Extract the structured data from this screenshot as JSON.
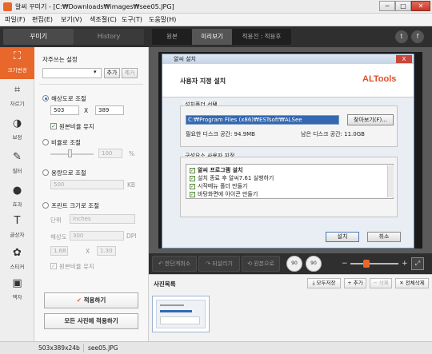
{
  "window": {
    "title": "알씨 꾸미기 - [C:₩Downloads₩images₩see05.JPG]",
    "min_label": "─",
    "max_label": "□",
    "close_label": "✕"
  },
  "menu": [
    "파일(F)",
    "편집(E)",
    "보기(V)",
    "색조절(C)",
    "도구(T)",
    "도움말(H)"
  ],
  "header": {
    "tabs": [
      "꾸미기",
      "History"
    ],
    "view_modes": [
      "원본",
      "미리보기",
      "적용전 : 적용후"
    ],
    "twitter": "t",
    "facebook": "f"
  },
  "sidebar": {
    "tools": [
      {
        "icon": "⛶",
        "label": "크기변경"
      },
      {
        "icon": "⌗",
        "label": "자르기"
      },
      {
        "icon": "◑",
        "label": "보정"
      },
      {
        "icon": "✎",
        "label": "필터"
      },
      {
        "icon": "●",
        "label": "효과"
      },
      {
        "icon": "T",
        "label": "글상자"
      },
      {
        "icon": "✿",
        "label": "스티커"
      },
      {
        "icon": "▣",
        "label": "액자"
      }
    ]
  },
  "panel": {
    "favorites_label": "자주쓰는 설정",
    "add_btn": "추가",
    "remove_btn": "제거",
    "resolution_label": "해상도로 조절",
    "width": "503",
    "x_sep": "X",
    "height": "389",
    "keep_ratio_label": "원본비율 유지",
    "keep_ratio_check": "✓",
    "ratio_label": "비율로 조절",
    "ratio_value": "100",
    "percent": "%",
    "filesize_label": "용량으로 조절",
    "filesize_value": "500",
    "kb": "KB",
    "print_label": "프린트 크기로 조절",
    "unit_label": "단위",
    "unit_value": "inches",
    "dpi_label": "해상도",
    "dpi_value": "300",
    "dpi_unit": "DPI",
    "print_w": "1.68",
    "print_h": "1.30",
    "print_keep_ratio": "원본비율 유지",
    "apply_btn": "적용하기",
    "apply_check": "✔",
    "apply_all_btn": "모든 사진에 적용하기"
  },
  "dialog": {
    "title": "알씨 설치",
    "close": "X",
    "heading": "사용자 지정 설치",
    "logo": "ALTools",
    "folder_group": "설치폴더 선택",
    "path": "C:₩Program Files (x86)₩ESTsoft₩ALSee",
    "browse_btn": "찾아보기(F)...",
    "disk_required": "필요한 디스크 공간: 94.9MB",
    "disk_free": "남은 디스크 공간: 11.0GB",
    "components_group": "구성요소 사용자 지정",
    "components": [
      "알씨 프로그램 설치",
      "설치 종료 후 알씨7.61 실행하기",
      "시작메뉴 폴더 만들기",
      "바탕화면에 아이콘 만들기"
    ],
    "check_mark": "✓",
    "install_btn": "설치",
    "cancel_btn": "취소"
  },
  "toolbar": {
    "undo": "↶ 한단계취소",
    "redo": "↷ 되살리기",
    "original": "⟲ 원본으로",
    "rot_left": "90",
    "rot_right": "90",
    "zoom_minus": "−",
    "zoom_plus": "+",
    "fit": "⤢",
    "zoom_level_fraction": 0.33
  },
  "photolist": {
    "label": "사진목록",
    "save_all": "모두저장",
    "add": "+ 추가",
    "delete": "− 삭제",
    "delete_all": "✕ 전체삭제"
  },
  "statusbar": {
    "dimensions": "503x389x24b",
    "filename": "see05.JPG"
  }
}
